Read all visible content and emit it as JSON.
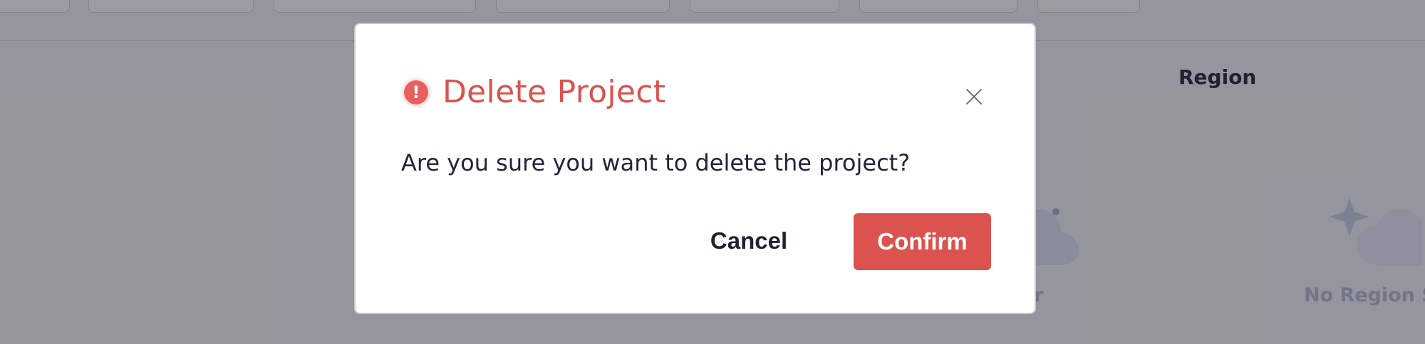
{
  "background": {
    "region_heading": "Region",
    "empty_region_label": "No Region S",
    "partial_left_label": "er"
  },
  "dialog": {
    "title": "Delete Project",
    "message": "Are you sure you want to delete the project?",
    "cancel_label": "Cancel",
    "confirm_label": "Confirm"
  },
  "colors": {
    "danger": "#db534f",
    "title": "#d9534f",
    "text": "#22253a",
    "overlay": "rgba(28,30,40,0.44)"
  },
  "icons": {
    "warning": "exclamation-circle-icon",
    "close": "close-icon",
    "cloud_empty": "cloud-icon"
  }
}
